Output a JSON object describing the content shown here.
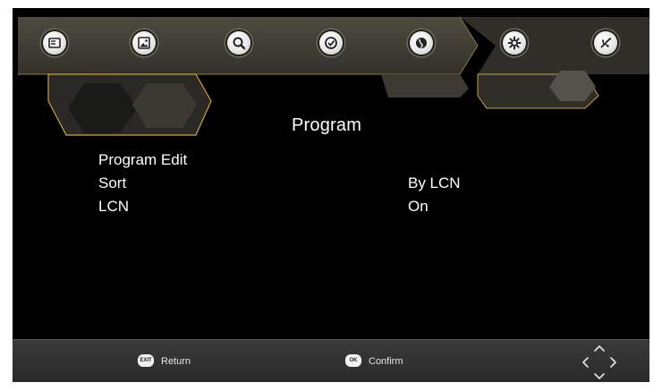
{
  "menu": {
    "title": "Program",
    "items": [
      {
        "label": "Program Edit",
        "value": ""
      },
      {
        "label": "Sort",
        "value": "By LCN"
      },
      {
        "label": "LCN",
        "value": "On"
      }
    ]
  },
  "top_icons": [
    {
      "name": "program-icon"
    },
    {
      "name": "picture-icon"
    },
    {
      "name": "search-icon"
    },
    {
      "name": "time-icon"
    },
    {
      "name": "globe-icon"
    },
    {
      "name": "gear-icon"
    },
    {
      "name": "usb-icon"
    }
  ],
  "footer": {
    "return_key": "EXIT",
    "return_label": "Return",
    "confirm_key": "OK",
    "confirm_label": "Confirm"
  },
  "colors": {
    "background": "#000000",
    "accent": "#d8b23a",
    "header": "#3f3d35",
    "text": "#ffffff"
  }
}
